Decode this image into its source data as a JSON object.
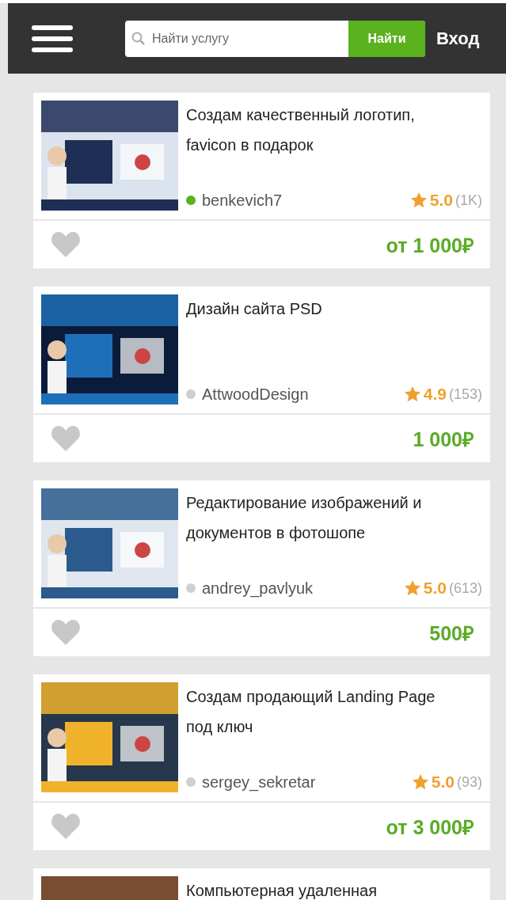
{
  "header": {
    "search": {
      "placeholder": "Найти услугу",
      "button": "Найти"
    },
    "login": "Вход"
  },
  "cards": [
    {
      "title": "Создам качественный логотип, favicon в подарок",
      "seller": "benkevich7",
      "online": true,
      "rating": "5.0",
      "reviews": "(1K)",
      "price": "от 1 000₽",
      "liked": false
    },
    {
      "title": "Дизайн сайта PSD",
      "seller": "AttwoodDesign",
      "online": false,
      "rating": "4.9",
      "reviews": "(153)",
      "price": "1 000₽",
      "liked": false
    },
    {
      "title": "Редактирование изображений и документов в фотошопе",
      "seller": "andrey_pavlyuk",
      "online": false,
      "rating": "5.0",
      "reviews": "(613)",
      "price": "500₽",
      "liked": false
    },
    {
      "title": "Создам продающий Landing Page под ключ",
      "seller": "sergey_sekretar",
      "online": false,
      "rating": "5.0",
      "reviews": "(93)",
      "price": "от 3 000₽",
      "liked": false
    },
    {
      "title": "Компьютерная удаленная"
    }
  ]
}
